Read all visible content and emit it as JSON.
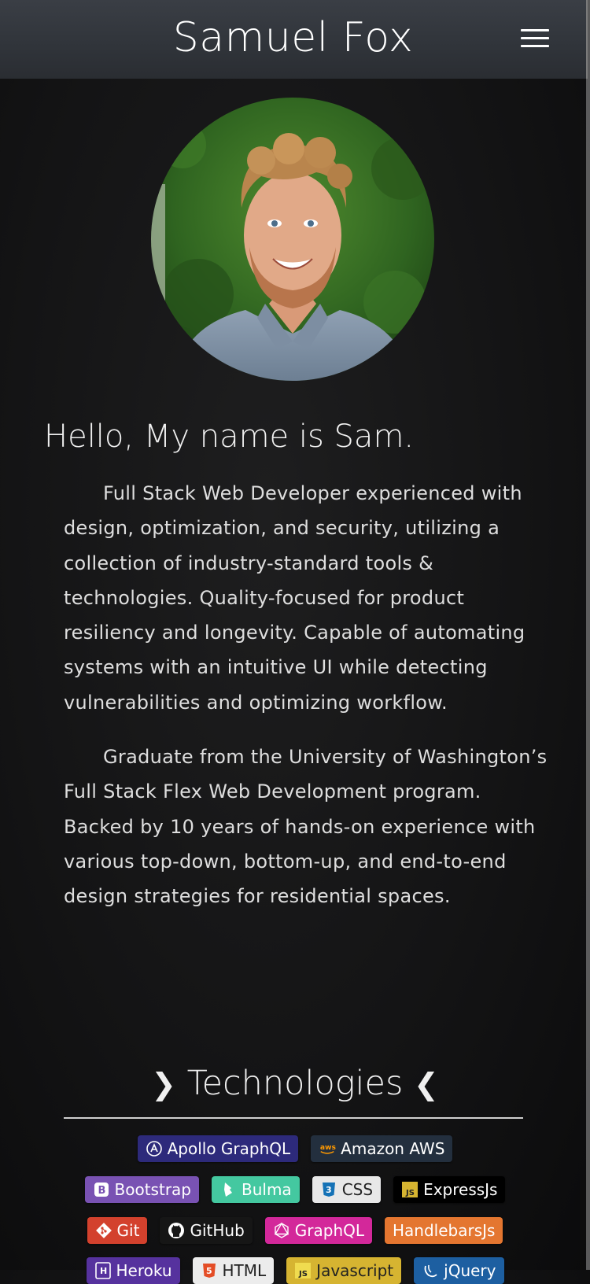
{
  "header": {
    "title": "Samuel Fox",
    "menu_icon": "hamburger-icon"
  },
  "about": {
    "greeting": "Hello, My name is Sam.",
    "bio_paragraph_1": "Full Stack Web Developer experienced with design, optimization, and security, utilizing a collection of industry-standard tools & technologies. Quality-focused for product resiliency and longevity. Capable of automating systems with an intuitive UI while detecting vulnerabilities and optimizing workflow.",
    "bio_paragraph_2": "Graduate from the University of Washington’s Full Stack Flex Web Development program. Backed by 10 years of hands-on experience with various top-down, bottom-up, and end-to-end design strategies for residential spaces."
  },
  "technologies": {
    "heading": "Technologies",
    "chevron_left": "❯",
    "chevron_right": "❮",
    "badges": [
      {
        "label": "Apollo GraphQL",
        "icon": "apollo-icon",
        "color": "#2d2a7b"
      },
      {
        "label": "Amazon AWS",
        "icon": "aws-icon",
        "color": "#232f3e"
      },
      {
        "label": "Bootstrap",
        "icon": "bootstrap-icon",
        "color": "#7952b3"
      },
      {
        "label": "Bulma",
        "icon": "bulma-icon",
        "color": "#44c8a0"
      },
      {
        "label": "CSS",
        "icon": "css-icon",
        "color": "#e8e8e8"
      },
      {
        "label": "ExpressJs",
        "icon": "expressjs-icon",
        "color": "#000000"
      },
      {
        "label": "Git",
        "icon": "git-icon",
        "color": "#d3412d"
      },
      {
        "label": "GitHub",
        "icon": "github-icon",
        "color": "#161616"
      },
      {
        "label": "GraphQL",
        "icon": "graphql-icon",
        "color": "#d3289a"
      },
      {
        "label": "HandlebarsJs",
        "icon": "handlebars-icon",
        "color": "#e47630"
      },
      {
        "label": "Heroku",
        "icon": "heroku-icon",
        "color": "#56329e"
      },
      {
        "label": "HTML",
        "icon": "html-icon",
        "color": "#ececec"
      },
      {
        "label": "Javascript",
        "icon": "javascript-icon",
        "color": "#d6b431"
      },
      {
        "label": "jQuery",
        "icon": "jquery-icon",
        "color": "#1d5fa1"
      }
    ]
  }
}
